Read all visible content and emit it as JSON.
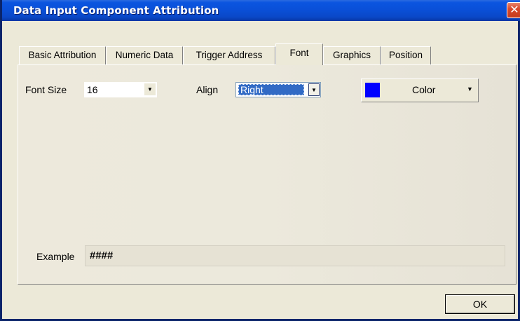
{
  "window": {
    "title": "Data Input Component Attribution",
    "close_label": "✕"
  },
  "tabs": [
    {
      "label": "Basic Attribution",
      "active": false
    },
    {
      "label": "Numeric Data",
      "active": false
    },
    {
      "label": "Trigger Address",
      "active": false
    },
    {
      "label": "Font",
      "active": true
    },
    {
      "label": "Graphics",
      "active": false
    },
    {
      "label": "Position",
      "active": false
    }
  ],
  "font": {
    "size_label": "Font Size",
    "size_value": "16",
    "align_label": "Align",
    "align_value": "Right",
    "color_label": "Color",
    "color_value": "#0000ff",
    "example_label": "Example",
    "example_text": "####"
  },
  "buttons": {
    "ok_label": "OK"
  },
  "icons": {
    "dropdown_arrow": "▼"
  }
}
